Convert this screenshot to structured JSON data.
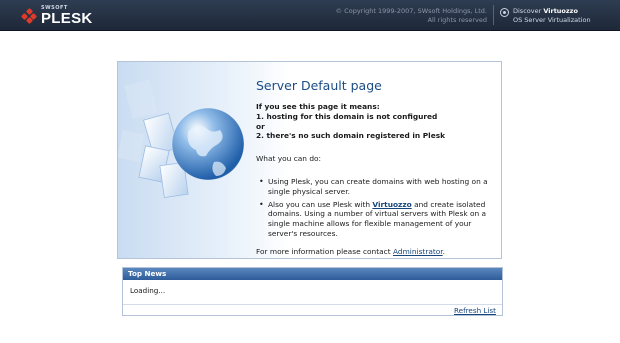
{
  "header": {
    "logo_small": "SWSOFT",
    "logo_big": "PLESK",
    "copyright_line1": "© Copyright 1999-2007, SWsoft Holdings, Ltd.",
    "copyright_line2": "All rights reserved",
    "discover_prefix": "Discover ",
    "discover_product": "Virtuozzo",
    "discover_line2": "OS Server Virtualization"
  },
  "main": {
    "title": "Server Default page",
    "bold_lines": [
      "If you see this page it means:",
      "1. hosting for this domain is not configured",
      "or",
      "2. there's no such domain registered in Plesk"
    ],
    "intro": "What you can do:",
    "bullet1": "Using Plesk, you can create domains with web hosting on a single physical server.",
    "bullet2_before": "Also you can use Plesk with ",
    "bullet2_link": "Virtuozzo",
    "bullet2_after": " and create isolated domains. Using a number of virtual servers with Plesk on a single machine allows for flexible management of your server's resources.",
    "contact_text": "For more information please contact ",
    "contact_link": "Administrator",
    "contact_end": "."
  },
  "news": {
    "title": "Top News",
    "status": "Loading...",
    "refresh_label": "Refresh List"
  },
  "icons": {
    "logo": "plesk-logo-icon",
    "discover": "virtuozzo-icon",
    "art": "globe-documents-icon"
  },
  "colors": {
    "header_bg": "#2f3d52",
    "title": "#1b4d86",
    "link": "#15457c",
    "news_header": "#3a68a8",
    "logo_red": "#e03a2a"
  }
}
